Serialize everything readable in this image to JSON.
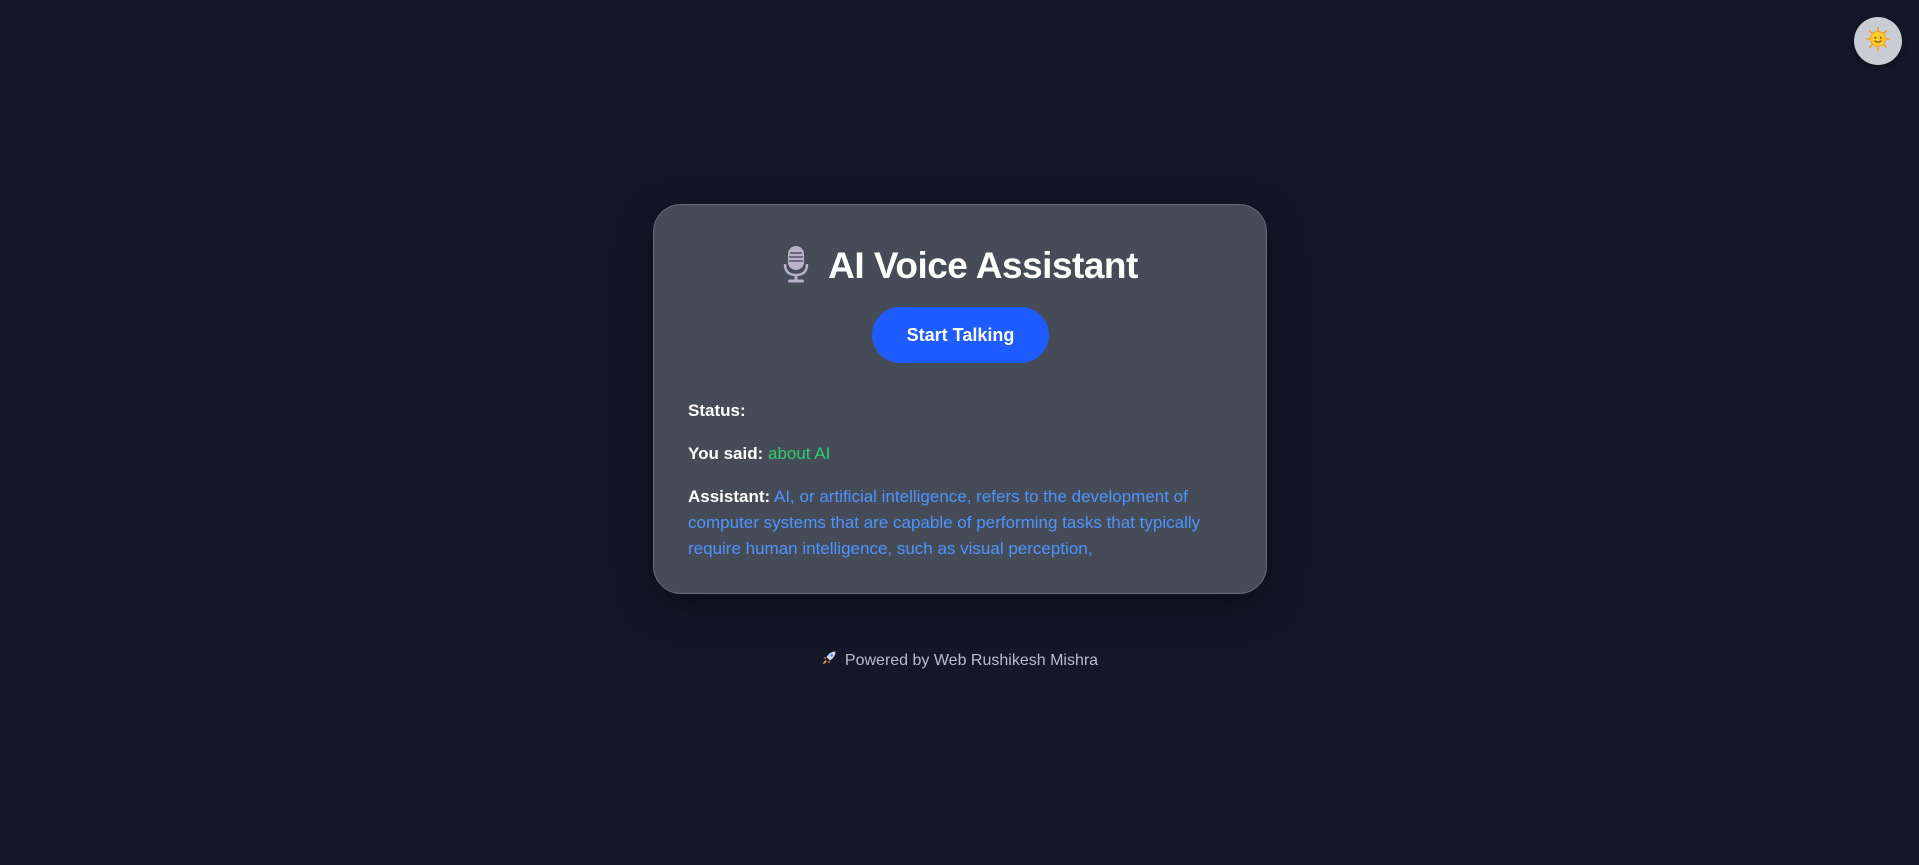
{
  "theme_toggle": {
    "icon": "sun-face-icon"
  },
  "card": {
    "title_icon": "microphone-icon",
    "title": "AI Voice Assistant",
    "start_button_label": "Start Talking",
    "status": {
      "label": "Status:",
      "value": ""
    },
    "you_said": {
      "label": "You said:",
      "value": "about AI"
    },
    "assistant": {
      "label": "Assistant:",
      "value": "AI, or artificial intelligence, refers to the development of computer systems that are capable of performing tasks that typically require human intelligence, such as visual perception,"
    }
  },
  "footer": {
    "icon": "rocket-icon",
    "text": "Powered by Web Rushikesh Mishra"
  },
  "colors": {
    "background": "#121828",
    "card": "#464b58",
    "button": "#1f5cff",
    "you_said_value": "#2fcf6f",
    "assistant_value": "#4d94ff"
  }
}
